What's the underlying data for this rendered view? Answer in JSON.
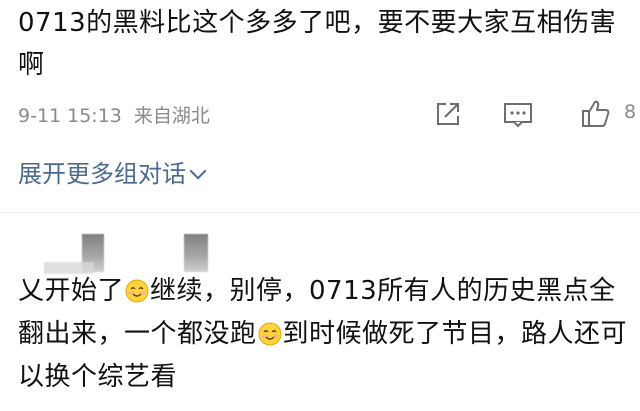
{
  "comment1": {
    "text": "0713的黑料比这个多多了吧，要不要大家互相伤害啊",
    "date": "9-11",
    "time": "15:13",
    "location": "来自湖北",
    "like_count": "8"
  },
  "expand_label": "展开更多组对话",
  "comment2": {
    "part1": "乂开始了",
    "emoji1": "smile-emoji",
    "part2": "继续，别停，0713所有人的历史黑点全翻出来，一个都没跑",
    "emoji2": "smile-emoji",
    "part3": "到时候做死了节目，路人还可以换个综艺看"
  },
  "icons": {
    "share": "share-icon",
    "comment": "comment-icon",
    "like": "thumbs-up-icon",
    "expand": "chevron-down-icon"
  },
  "colors": {
    "text": "#111111",
    "meta": "#8a8a8a",
    "link": "#4a6a93",
    "icon": "#6e6e6e"
  }
}
